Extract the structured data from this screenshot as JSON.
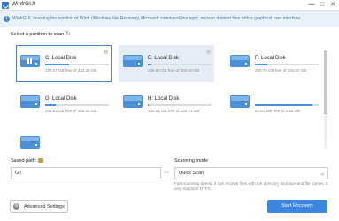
{
  "window": {
    "title": "WinfrGUI",
    "controls": [
      "—",
      "□",
      "✕"
    ]
  },
  "info_bar": {
    "text": "WinfrGUI, invoking the function of Winfr (Windows File Recovery, Microsoft command-line app), recover deleted files with a graphical user interface."
  },
  "partitions": {
    "label": "Select a partition to scan",
    "items": [
      {
        "name": "C: Local Disk",
        "space": "137.27 GB free of 222.30 GB",
        "used_fraction": 0.38,
        "state": "selected",
        "type": "system"
      },
      {
        "name": "E: Local Disk",
        "space": "238.59 GB free of 250.00 GB",
        "used_fraction": 0.05,
        "state": "hovered",
        "type": "disk"
      },
      {
        "name": "F: Local Disk",
        "space": "200.79 GB free of 250.00 GB",
        "used_fraction": 0.2,
        "state": "normal",
        "type": "disk"
      },
      {
        "name": "G: Local Disk",
        "space": "251.93 GB free of 300.00 GB",
        "used_fraction": 0.16,
        "state": "normal",
        "type": "disk"
      },
      {
        "name": "H: Local Disk",
        "space": "130.01 GB free of 130.71 GB",
        "used_fraction": 0.01,
        "state": "normal",
        "type": "disk"
      },
      {
        "name": "",
        "space": "54.81 MB free of 0.56 GB",
        "used_fraction": 0.9,
        "state": "normal",
        "type": "usb"
      },
      {
        "name": "",
        "space": "",
        "used_fraction": 0,
        "state": "normal",
        "type": "usb"
      }
    ]
  },
  "save_path": {
    "label": "Saved path:",
    "value": "G:\\"
  },
  "scanning_mode": {
    "label": "Scanning mode",
    "value": "Quick Scan",
    "description": "Fast scanning speed. It can recover files with the directory structure and file names. It only supports NTFS."
  },
  "buttons": {
    "advanced": "Advanced Settings",
    "start": "Start Recovery"
  },
  "colors": {
    "accent": "#3a86e0",
    "disk": "#4a90d9"
  }
}
